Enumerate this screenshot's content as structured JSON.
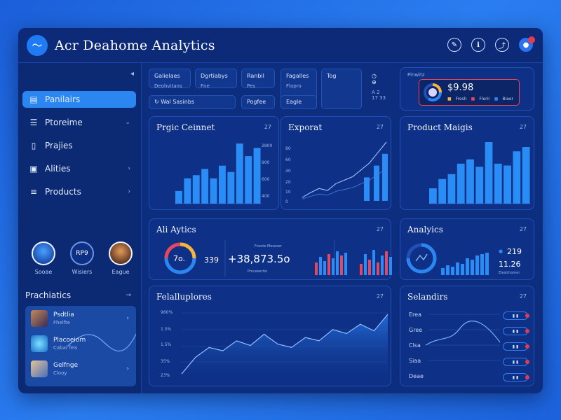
{
  "app": {
    "title": "Acr Deahome Analytics",
    "logo_icon": "wave-icon"
  },
  "topbar": {
    "icons": [
      "edit-icon",
      "info-icon",
      "share-icon",
      "user-icon"
    ]
  },
  "sidebar": {
    "collapse_symbol": "◂",
    "items": [
      {
        "label": "Panilairs",
        "icon": "folder-icon",
        "active": true,
        "chevron": ""
      },
      {
        "label": "Ptoreime",
        "icon": "menu-icon",
        "active": false,
        "chevron": "⌄"
      },
      {
        "label": "Prajies",
        "icon": "document-icon",
        "active": false,
        "chevron": ""
      },
      {
        "label": "Alities",
        "icon": "image-icon",
        "active": false,
        "chevron": "›"
      },
      {
        "label": "Products",
        "icon": "list-icon",
        "active": false,
        "chevron": "›"
      }
    ],
    "people": [
      {
        "label": "Sooae",
        "initials": ""
      },
      {
        "label": "Wisiers",
        "initials": "RP9"
      },
      {
        "label": "Eague",
        "initials": ""
      }
    ],
    "practices_title": "Prachiatics",
    "practices_arrow": "→",
    "practices": [
      {
        "title": "Psdtlia",
        "sub": "Fhelfte"
      },
      {
        "title": "Placoeiom",
        "sub": "Cabai feis"
      },
      {
        "title": "Gelfnge",
        "sub": "Clooy"
      }
    ]
  },
  "top_tiles": [
    {
      "l1": "Galielaes",
      "l2": "Deohvitans"
    },
    {
      "l1": "Dgrtiabys",
      "l2": "Fne"
    },
    {
      "l1": "Ranbil",
      "l2": "Pes"
    },
    {
      "l1": "Fagalles",
      "l2": "Flapro"
    },
    {
      "l1": "Tog",
      "l2": ""
    },
    {
      "l1": "◷ ⊕",
      "l2": "A 2\n17 33"
    }
  ],
  "top_tiles_row2": [
    "Wal Sasinbs",
    "Pogfee",
    "Eagle"
  ],
  "kpi_card": {
    "label": "Pinwitz",
    "value": "$9.98",
    "legend": [
      "Fresh",
      "Flerir",
      "Bieer"
    ]
  },
  "cards": {
    "program": {
      "title": "Prgic Ceinnet",
      "badge": "27",
      "ylabels": [
        "2800",
        "900",
        "600",
        "400"
      ]
    },
    "export": {
      "title": "Exporat",
      "badge": "27",
      "ylabels": [
        "80",
        "60",
        "40",
        "20",
        "10",
        "0"
      ]
    },
    "product": {
      "title": "Product Maigis",
      "badge": "27"
    },
    "analytics_wide": {
      "title": "Ali Aytics",
      "badge": "27",
      "gauge": "7o.",
      "v1": "339",
      "v2": "+38,873.5o",
      "leg1": "Fooste Meseser",
      "leg2": "Prncesertio"
    },
    "analytics_small": {
      "title": "Analyics",
      "badge": "27",
      "v1": "219",
      "v2": "11.26",
      "leg": "Elestrhomei"
    },
    "features": {
      "title": "Felalluplores",
      "badge": "27",
      "ylabels": [
        "960%",
        "1.5%",
        "1.5%",
        "35%",
        "23%"
      ]
    },
    "selandirs": {
      "title": "Selandirs",
      "badge": "27",
      "rows": [
        "Erea",
        "Gree",
        "Clsa",
        "Siaa",
        "Deae"
      ]
    }
  },
  "colors": {
    "accent": "#2b86f2",
    "bar": "#2a8df5",
    "red": "#e83a4a",
    "bg": "#0d2d7e"
  },
  "chart_data": [
    {
      "type": "bar",
      "title": "Prgic Ceinnet",
      "values": [
        20,
        40,
        45,
        55,
        40,
        60,
        50,
        95,
        75,
        88
      ]
    },
    {
      "type": "line",
      "title": "Exporat",
      "values": [
        5,
        12,
        18,
        15,
        25,
        30,
        35,
        45,
        55,
        70,
        85
      ]
    },
    {
      "type": "bar",
      "title": "Product Maigis",
      "values": [
        25,
        40,
        48,
        65,
        72,
        60,
        100,
        65,
        62,
        85,
        92
      ]
    },
    {
      "type": "area",
      "title": "Felalluplores",
      "values": [
        5,
        30,
        45,
        40,
        55,
        48,
        65,
        50,
        45,
        60,
        55,
        72,
        66,
        80,
        70,
        95
      ]
    }
  ]
}
